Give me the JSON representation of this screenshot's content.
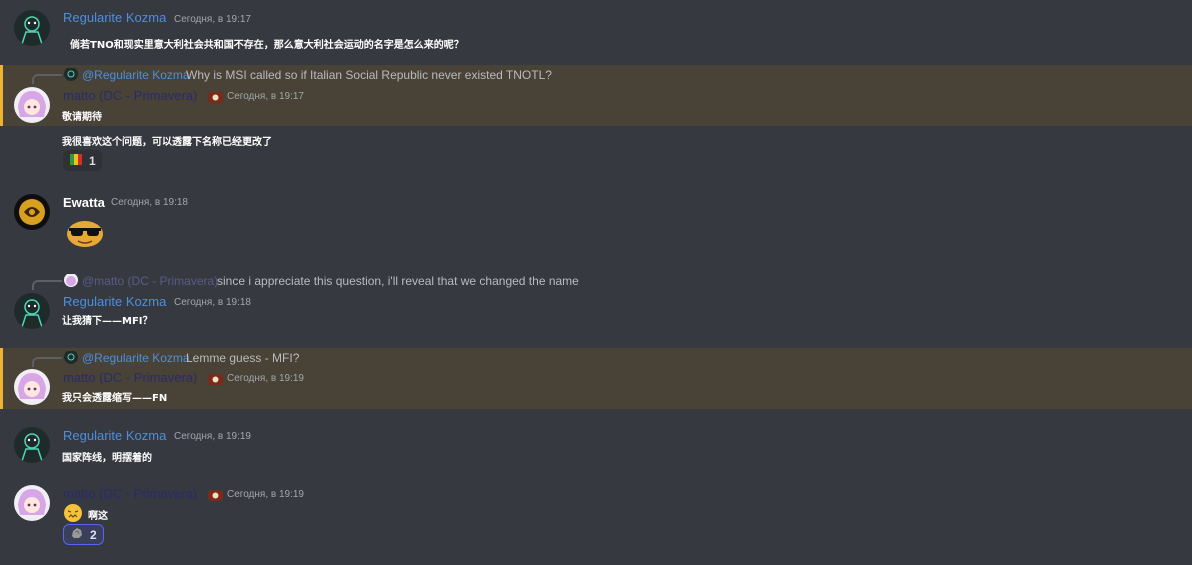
{
  "messages": [
    {
      "author": "Regularite Kozma",
      "timestamp": "Сегодня, в 19:17",
      "text": "倘若TNO和现实里意大利社会共和国不存在，那么意大利社会运动的名字是怎么来的呢？"
    },
    {
      "reply_mention": "@Regularite Kozma",
      "reply_text": "Why is MSI called so if Italian Social Republic never existed TNOTL?",
      "author": "matto (DC - Primavera)",
      "timestamp": "Сегодня, в 19:17",
      "text": "敬请期待"
    },
    {
      "text": "我很喜欢这个问题，可以透露下名称已经更改了",
      "reaction": {
        "emoji": "flag-emoji",
        "count": "1"
      }
    },
    {
      "author": "Ewatta",
      "timestamp": "Сегодня, в 19:18",
      "sticker": "sunglasses-emoji"
    },
    {
      "reply_mention": "@matto (DC - Primavera)",
      "reply_text": "since i appreciate this question, i'll reveal that we changed the name",
      "author": "Regularite Kozma",
      "timestamp": "Сегодня, в 19:18",
      "text": "让我猜下——MFI？"
    },
    {
      "reply_mention": "@Regularite Kozma",
      "reply_text": "Lemme guess - MFI?",
      "author": "matto (DC - Primavera)",
      "timestamp": "Сегодня, в 19:19",
      "text": "我只会透露缩写——FN"
    },
    {
      "author": "Regularite Kozma",
      "timestamp": "Сегодня, в 19:19",
      "text": "国家阵线，明摆着的"
    },
    {
      "author": "matto (DC - Primavera)",
      "timestamp": "Сегодня, в 19:19",
      "text": "啊这",
      "inline_emoji": "confounded-emoji",
      "reaction": {
        "emoji": "rock-emoji",
        "count": "2"
      }
    }
  ],
  "colors": {
    "background": "#36393f",
    "highlight": "#484237",
    "mention_bar": "#f0b232",
    "link_blue": "#4c8fe0"
  }
}
